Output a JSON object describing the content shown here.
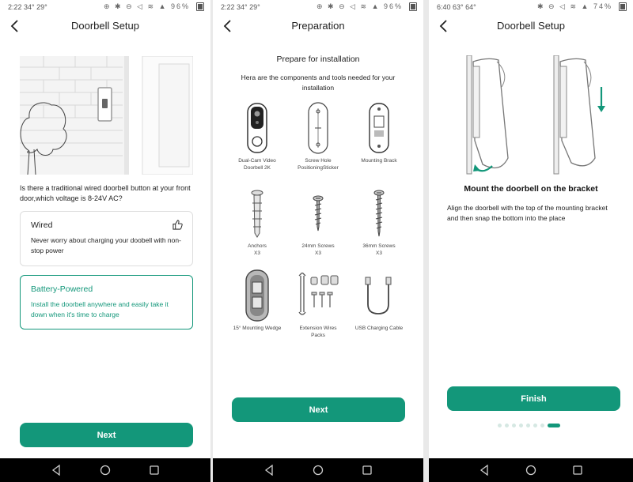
{
  "colors": {
    "accent": "#13977a",
    "navbar": "#000000",
    "option_border": "#dedede"
  },
  "screens": [
    {
      "status": {
        "time": "2:22",
        "temp": "34° 29°",
        "battery": "96%"
      },
      "header": {
        "title": "Doorbell Setup",
        "back_icon": "chevron-left-icon"
      },
      "question": "Is there a traditional wired doorbell button at your front door,which voltage is 8-24V AC?",
      "options": [
        {
          "title": "Wired",
          "desc": "Never worry about charging your doobell with non-stop power",
          "icon": "thumbs-up-icon",
          "selected": false
        },
        {
          "title": "Battery-Powered",
          "desc": "Install the doorbell anywhere and easily take it down when it's time to charge",
          "selected": true
        }
      ],
      "next_label": "Next"
    },
    {
      "status": {
        "time": "2:22",
        "temp": "34° 29°",
        "battery": "96%"
      },
      "header": {
        "title": "Preparation",
        "back_icon": "chevron-left-icon"
      },
      "title": "Prepare for installation",
      "subtitle": "Hera are the components and tools needed for your installation",
      "items": [
        {
          "l1": "Dual-Cam Video",
          "l2": "Doorbell 2K"
        },
        {
          "l1": "Screw Hole",
          "l2": "PositioningSticker"
        },
        {
          "l1": "Mounting Brack",
          "l2": ""
        },
        {
          "l1": "Anchors",
          "l2": "X3"
        },
        {
          "l1": "24mm Screws",
          "l2": "X3"
        },
        {
          "l1": "36mm Screws",
          "l2": "X3"
        },
        {
          "l1": "15° Mounting Wedge",
          "l2": ""
        },
        {
          "l1": "Extension Wires",
          "l2": "Packs"
        },
        {
          "l1": "USB Charging Cable",
          "l2": ""
        }
      ],
      "next_label": "Next"
    },
    {
      "status": {
        "time": "6:40",
        "temp": "63° 64°",
        "battery": "74%"
      },
      "header": {
        "title": "Doorbell Setup",
        "back_icon": "chevron-left-icon"
      },
      "title": "Mount the doorbell on the bracket",
      "desc": "Align the doorbell with the top of the mounting bracket and then snap the bottom into the place",
      "finish_label": "Finish",
      "pager": {
        "count": 8,
        "active": 7
      }
    }
  ],
  "navbar": {
    "back": "nav-back-icon",
    "home": "nav-home-icon",
    "recents": "nav-recents-icon"
  }
}
